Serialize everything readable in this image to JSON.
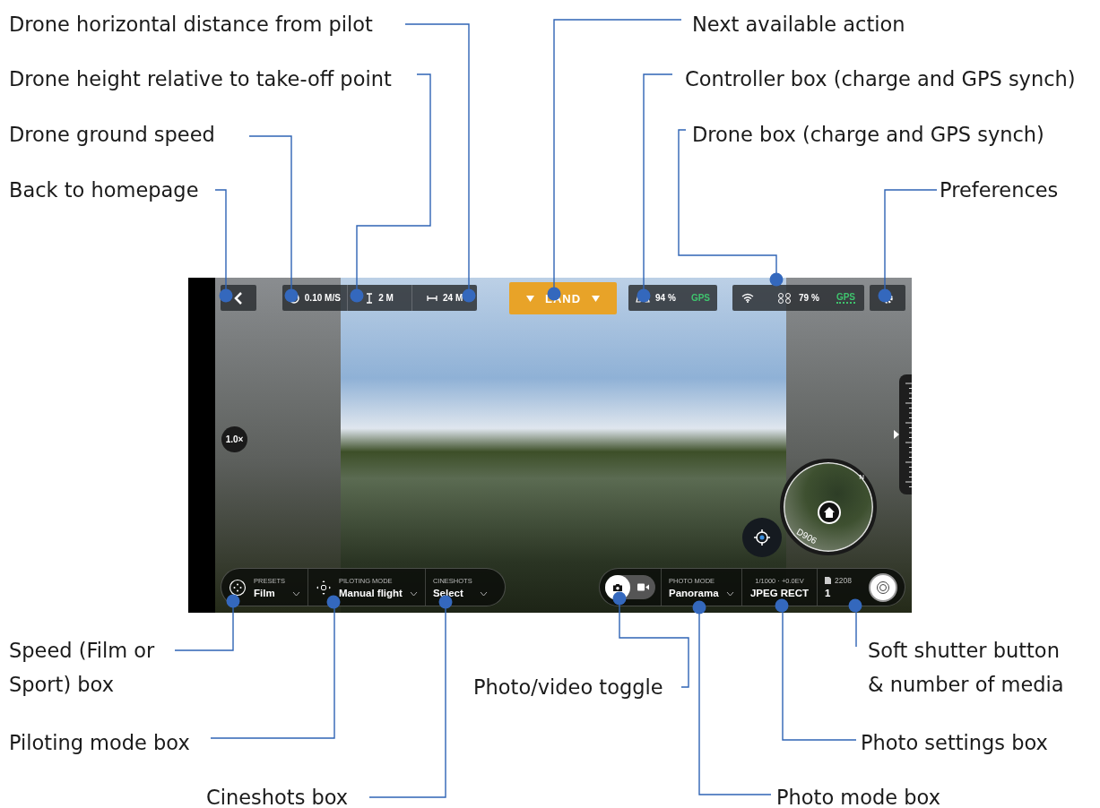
{
  "callouts": [
    {
      "text": "Drone horizontal distance from pilot"
    },
    {
      "text": "Next available action"
    },
    {
      "text": "Drone height relative to take-off point"
    },
    {
      "text": "Controller box (charge and GPS synch)"
    },
    {
      "text": "Drone ground speed"
    },
    {
      "text": "Drone box (charge and GPS synch)"
    },
    {
      "text": "Back to homepage"
    },
    {
      "text": "Preferences"
    },
    {
      "text": "Speed (Film or Sport) box"
    },
    {
      "text": "Photo/video toggle"
    },
    {
      "text": "Soft shutter button & number of media"
    },
    {
      "text": "Piloting mode box"
    },
    {
      "text": "Photo settings box"
    },
    {
      "text": "Cineshots box"
    },
    {
      "text": "Photo mode box"
    }
  ],
  "screen": {
    "top_bar": {
      "speed": "0.10 M/S",
      "height": "2 M",
      "distance": "24 M",
      "action": "LAND",
      "controller": {
        "battery": "94 %",
        "gps": "GPS"
      },
      "drone": {
        "battery": "79 %",
        "gps": "GPS"
      }
    },
    "zoom": "1.0×",
    "map": {
      "north": "N",
      "road": "D906"
    },
    "left_bar": [
      {
        "kind": "presets",
        "label": "PRESETS",
        "value": "Film"
      },
      {
        "kind": "piloting",
        "label": "PILOTING MODE",
        "value": "Manual flight"
      },
      {
        "kind": "cineshots",
        "label": "CINESHOTS",
        "value": "Select"
      }
    ],
    "capture_toggle": [
      {
        "kind": "photo",
        "selected": true
      },
      {
        "kind": "video",
        "selected": false
      }
    ],
    "photo_mode": {
      "label": "PHOTO MODE",
      "value": "Panorama"
    },
    "photo_settings": {
      "exposure": "1/1000 · +0.0EV",
      "format": "JPEG RECT"
    },
    "media": {
      "count": "2208",
      "value": "1"
    }
  }
}
